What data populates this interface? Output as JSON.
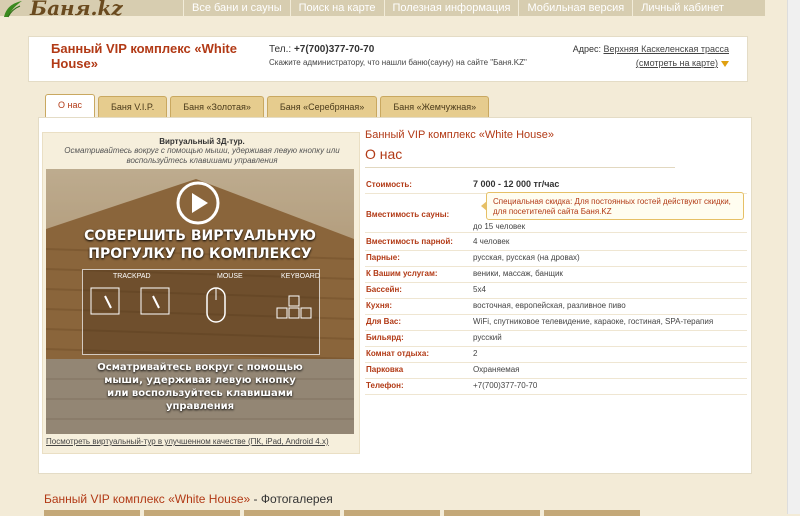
{
  "site": {
    "logo_text": "Баня.kz"
  },
  "nav": [
    "Все бани и сауны",
    "Поиск на карте",
    "Полезная информация",
    "Мобильная версия",
    "Личный кабинет"
  ],
  "header": {
    "title": "Банный VIP комплекс «White House»",
    "tel_label": "Тел.:",
    "tel": "+7(700)377-70-70",
    "hint": "Скажите администратору, что нашли баню(сауну) на сайте \"Баня.KZ\"",
    "addr_label": "Адрес:",
    "addr": "Верхняя Каскеленская трасса",
    "map_link": "(смотреть на карте)"
  },
  "tabs": [
    "О нас",
    "Баня V.I.P.",
    "Баня «Золотая»",
    "Баня «Серебряная»",
    "Баня «Жемчужная»"
  ],
  "tour": {
    "title": "Виртуальный 3Д-тур.",
    "desc": "Осматривайтесь вокруг с помощью мыши, удерживая левую кнопку или воспользуйтесь клавишами управления",
    "img_heading": "СОВЕРШИТЬ ВИРТУАЛЬНУЮ ПРОГУЛКУ ПО КОМПЛЕКСУ",
    "img_trackpad": "TRACKPAD",
    "img_mouse": "MOUSE",
    "img_keyboard": "KEYBOARD",
    "img_caption": "Осматривайтесь вокруг с помощью мыши, удерживая левую кнопку или воспользуйтесь клавишами управления",
    "link": "Посмотреть виртуальный-тур в улучшенном качестве (ПК, iPad, Android 4.x)"
  },
  "about": {
    "name": "Банный VIP комплекс «White House»",
    "section": "О нас",
    "rows": [
      {
        "k": "Стоимость:",
        "v": "7 000 - 12 000 тг/час"
      },
      {
        "k": "Вместимость сауны:",
        "v": "до 15 человек"
      },
      {
        "k": "Вместимость парной:",
        "v": "4 человек"
      },
      {
        "k": "Парные:",
        "v": "русская, русская (на дровах)"
      },
      {
        "k": "К Вашим услугам:",
        "v": "веники, массаж, банщик"
      },
      {
        "k": "Бассейн:",
        "v": "5x4"
      },
      {
        "k": "Кухня:",
        "v": "восточная, европейская, разливное пиво"
      },
      {
        "k": "Для Вас:",
        "v": "WiFi, спутниковое телевидение, караоке, гостиная, SPA-терапия"
      },
      {
        "k": "Бильярд:",
        "v": "русский"
      },
      {
        "k": "Комнат отдыха:",
        "v": "2"
      },
      {
        "k": "Парковка",
        "v": "Охраняемая"
      },
      {
        "k": "Телефон:",
        "v": "+7(700)377-70-70"
      }
    ],
    "discount": "Специальная скидка: Для постоянных гостей действуют скидки, для посетителей сайта Баня.KZ"
  },
  "gallery": {
    "title": "Банный VIP комплекс «White House»",
    "suffix": " - Фотогалерея"
  },
  "colors": {
    "accent": "#b23a16",
    "nav_bg": "#d7cdb0",
    "tab_bg": "#e6cc8e",
    "page_bg": "#f3ebd7"
  }
}
